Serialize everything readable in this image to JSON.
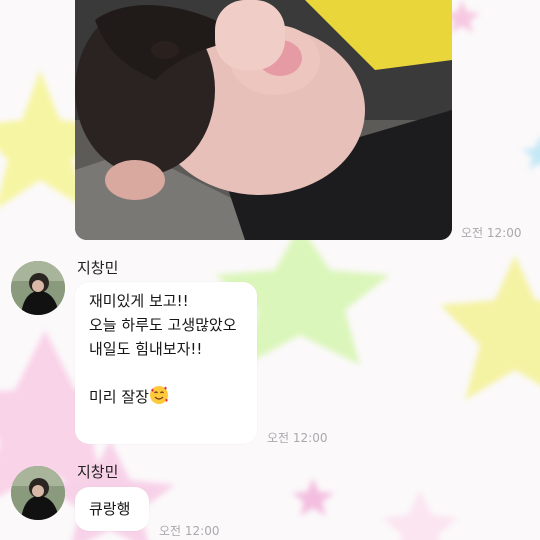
{
  "messages": [
    {
      "type": "photo",
      "time": "오전 12:00"
    },
    {
      "type": "text",
      "sender": "지창민",
      "lines": [
        "재미있게 보고!!",
        "오늘 하루도 고생많았오",
        "내일도 힘내보자!!",
        "",
        "미리 잘장"
      ],
      "emoji": "smiling-face-with-hearts",
      "time": "오전 12:00"
    },
    {
      "type": "text",
      "sender": "지창민",
      "lines": [
        "큐랑행"
      ],
      "time": "오전 12:00"
    }
  ],
  "colors": {
    "star_yellow": "#f6f59a",
    "star_green": "#d8f6b4",
    "star_pink": "#f9cfe6",
    "bubble": "#ffffff",
    "timestamp": "#a9a9ad"
  }
}
